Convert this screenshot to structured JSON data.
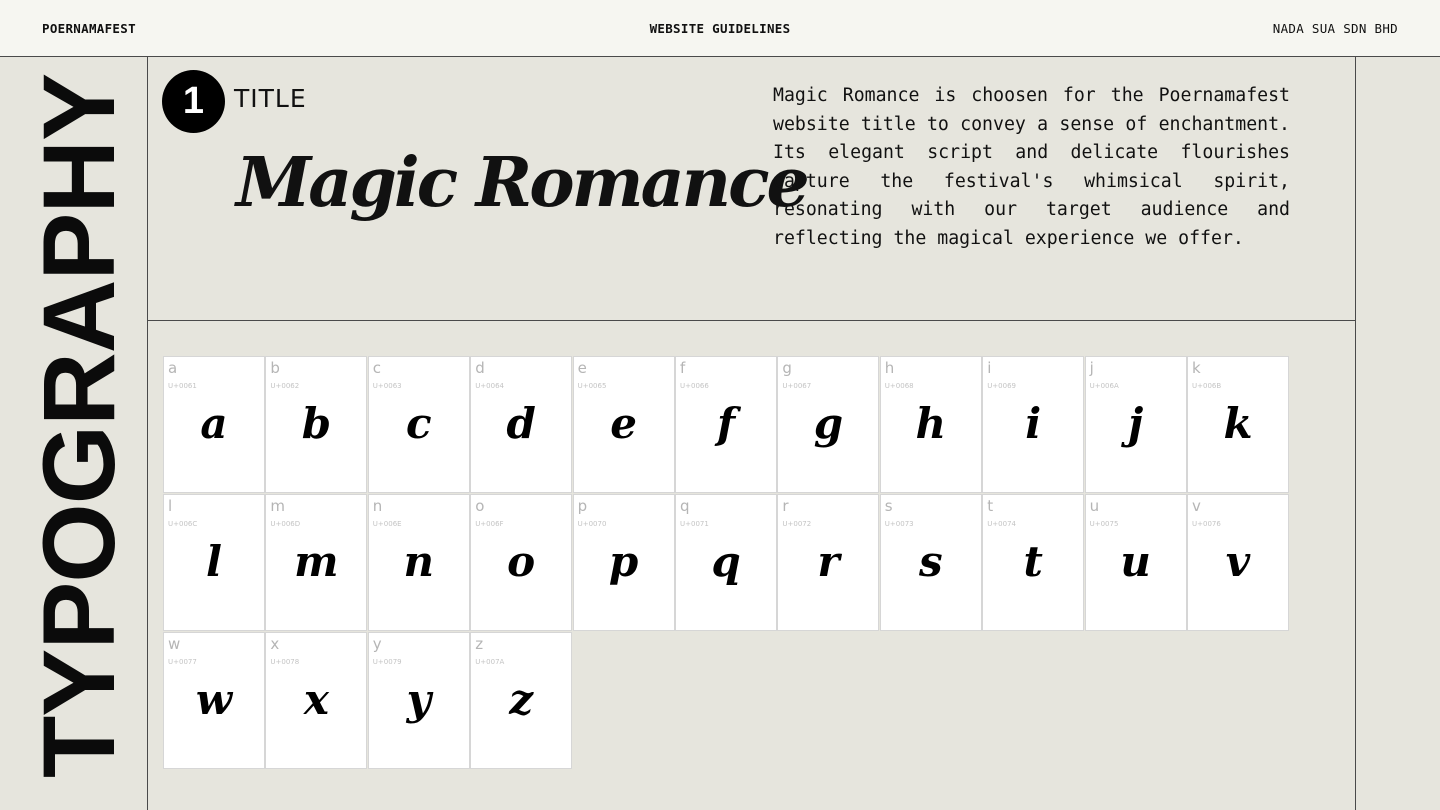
{
  "header": {
    "left": "POERNAMAFEST",
    "center": "WEBSITE GUIDELINES",
    "right": "NADA SUA SDN BHD"
  },
  "side_title": "TYPOGRAPHY",
  "section": {
    "number": "1",
    "label": "TITLE",
    "font_name": "Magic Romance",
    "description": "Magic Romance is choosen for the Poernamafest website title to convey a sense of enchantment. Its elegant script and delicate flourishes capture the festival's whimsical spirit, resonating with our target audience and reflecting the magical experience we offer."
  },
  "glyphs": [
    {
      "name": "a",
      "code": "U+0061",
      "glyph": "a"
    },
    {
      "name": "b",
      "code": "U+0062",
      "glyph": "b"
    },
    {
      "name": "c",
      "code": "U+0063",
      "glyph": "c"
    },
    {
      "name": "d",
      "code": "U+0064",
      "glyph": "d"
    },
    {
      "name": "e",
      "code": "U+0065",
      "glyph": "e"
    },
    {
      "name": "f",
      "code": "U+0066",
      "glyph": "f"
    },
    {
      "name": "g",
      "code": "U+0067",
      "glyph": "g"
    },
    {
      "name": "h",
      "code": "U+0068",
      "glyph": "h"
    },
    {
      "name": "i",
      "code": "U+0069",
      "glyph": "i"
    },
    {
      "name": "j",
      "code": "U+006A",
      "glyph": "j"
    },
    {
      "name": "k",
      "code": "U+006B",
      "glyph": "k"
    },
    {
      "name": "l",
      "code": "U+006C",
      "glyph": "l"
    },
    {
      "name": "m",
      "code": "U+006D",
      "glyph": "m"
    },
    {
      "name": "n",
      "code": "U+006E",
      "glyph": "n"
    },
    {
      "name": "o",
      "code": "U+006F",
      "glyph": "o"
    },
    {
      "name": "p",
      "code": "U+0070",
      "glyph": "p"
    },
    {
      "name": "q",
      "code": "U+0071",
      "glyph": "q"
    },
    {
      "name": "r",
      "code": "U+0072",
      "glyph": "r"
    },
    {
      "name": "s",
      "code": "U+0073",
      "glyph": "s"
    },
    {
      "name": "t",
      "code": "U+0074",
      "glyph": "t"
    },
    {
      "name": "u",
      "code": "U+0075",
      "glyph": "u"
    },
    {
      "name": "v",
      "code": "U+0076",
      "glyph": "v"
    },
    {
      "name": "w",
      "code": "U+0077",
      "glyph": "w"
    },
    {
      "name": "x",
      "code": "U+0078",
      "glyph": "x"
    },
    {
      "name": "y",
      "code": "U+0079",
      "glyph": "y"
    },
    {
      "name": "z",
      "code": "U+007A",
      "glyph": "z"
    }
  ]
}
